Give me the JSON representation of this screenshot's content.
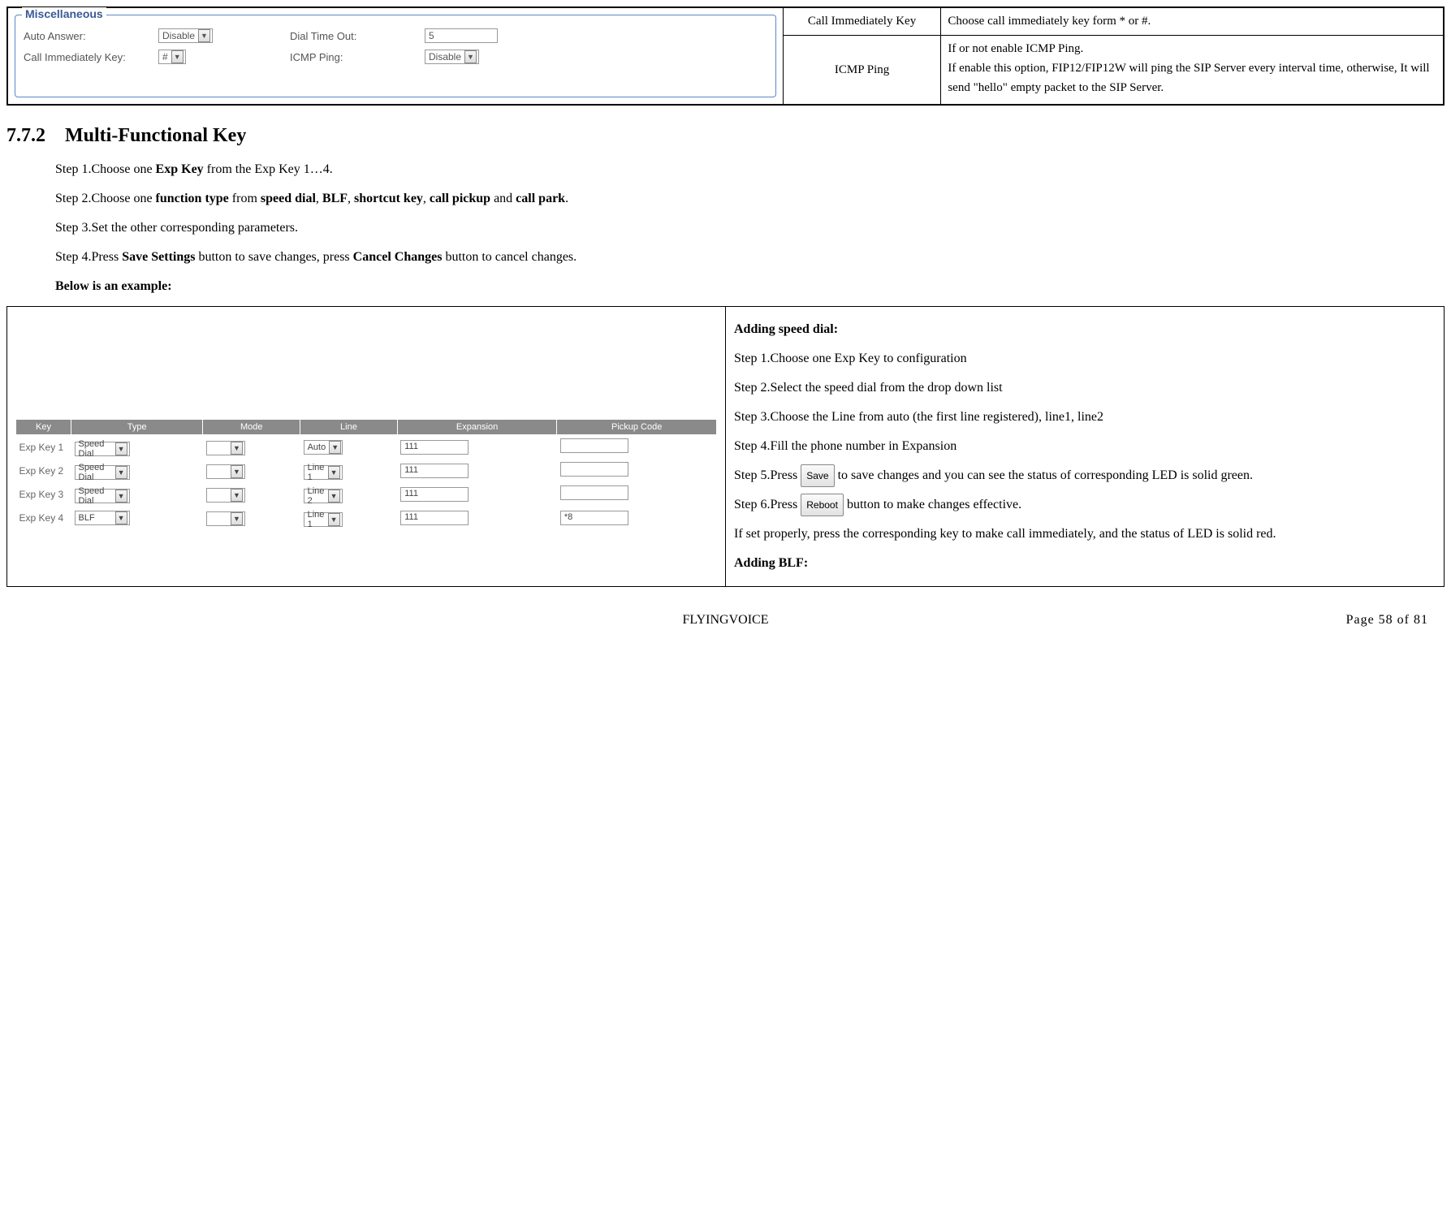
{
  "misc": {
    "legend": "Miscellaneous",
    "auto_answer_label": "Auto Answer:",
    "auto_answer_value": "Disable",
    "dial_timeout_label": "Dial Time Out:",
    "dial_timeout_value": "5",
    "call_immediately_label": "Call Immediately Key:",
    "call_immediately_value": "#",
    "icmp_ping_label": "ICMP Ping:",
    "icmp_ping_value": "Disable"
  },
  "desc_rows": {
    "call_immediately_name": "Call Immediately Key",
    "call_immediately_desc": "Choose call immediately key form * or #.",
    "icmp_name": "ICMP Ping",
    "icmp_desc": "If or not enable ICMP Ping.\nIf enable this option, FIP12/FIP12W will ping the SIP Server every interval time, otherwise, It will send \"hello\" empty packet to the SIP Server."
  },
  "section": {
    "number": "7.7.2",
    "title": "Multi-Functional Key"
  },
  "steps": {
    "s1_pre": "Step 1.Choose one ",
    "s1_bold": "Exp Key",
    "s1_post": " from the Exp Key 1…4.",
    "s2_pre": "Step 2.Choose one ",
    "s2_b1": "function type",
    "s2_mid1": " from ",
    "s2_b2": "speed dial",
    "s2_mid2": ", ",
    "s2_b3": "BLF",
    "s2_mid3": ", ",
    "s2_b4": "shortcut key",
    "s2_mid4": ", ",
    "s2_b5": "call pickup",
    "s2_mid5": " and ",
    "s2_b6": "call park",
    "s2_end": ".",
    "s3": "Step 3.Set the other corresponding parameters.",
    "s4_pre": "Step 4.Press ",
    "s4_b1": "Save Settings",
    "s4_mid": " button to save changes, press ",
    "s4_b2": "Cancel Changes",
    "s4_post": " button to cancel changes.",
    "below": "Below is an example:"
  },
  "exp_table": {
    "headers": {
      "key": "Key",
      "type": "Type",
      "mode": "Mode",
      "line": "Line",
      "expansion": "Expansion",
      "pickup": "Pickup Code"
    },
    "rows": [
      {
        "key": "Exp Key 1",
        "type": "Speed Dial",
        "mode": "",
        "line": "Auto",
        "expansion": "111",
        "pickup": ""
      },
      {
        "key": "Exp Key 2",
        "type": "Speed Dial",
        "mode": "",
        "line": "Line 1",
        "expansion": "111",
        "pickup": ""
      },
      {
        "key": "Exp Key 3",
        "type": "Speed Dial",
        "mode": "",
        "line": "Line 2",
        "expansion": "111",
        "pickup": ""
      },
      {
        "key": "Exp Key 4",
        "type": "BLF",
        "mode": "",
        "line": "Line 1",
        "expansion": "111",
        "pickup": "*8"
      }
    ]
  },
  "adding": {
    "title1": "Adding speed dial:",
    "s1": "Step 1.Choose one Exp Key to configuration",
    "s2": "Step 2.Select the speed dial from the drop down list",
    "s3": "Step 3.Choose the Line from auto (the first line registered), line1, line2",
    "s4": "Step 4.Fill the phone number in Expansion",
    "s5_pre": "Step 5.Press ",
    "s5_btn": "Save",
    "s5_post": " to save changes and you can see the status of corresponding LED is solid green.",
    "s6_pre": "Step 6.Press ",
    "s6_btn": "Reboot",
    "s6_post": " button to make changes effective.",
    "s7": "If set properly, press the corresponding key to make call immediately, and the status of LED is solid red.",
    "title2": "Adding BLF:"
  },
  "footer": {
    "center": "FLYINGVOICE",
    "right": "Page 58 of 81"
  }
}
